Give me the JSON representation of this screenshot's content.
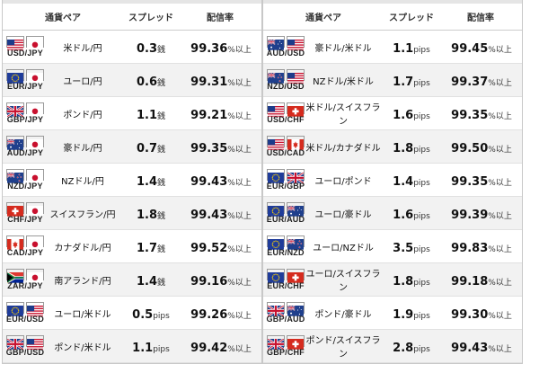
{
  "headers": {
    "pair": "通貨ペア",
    "spread": "スプレッド",
    "rate": "配信率"
  },
  "left": [
    {
      "code": "USD/JPY",
      "f1": "us",
      "f2": "jp",
      "name": "米ドル/円",
      "spread": "0.3",
      "unit": "銭",
      "rate": "99.36",
      "rate_unit": "%以上"
    },
    {
      "code": "EUR/JPY",
      "f1": "eu",
      "f2": "jp",
      "name": "ユーロ/円",
      "spread": "0.6",
      "unit": "銭",
      "rate": "99.31",
      "rate_unit": "%以上"
    },
    {
      "code": "GBP/JPY",
      "f1": "gb",
      "f2": "jp",
      "name": "ポンド/円",
      "spread": "1.1",
      "unit": "銭",
      "rate": "99.21",
      "rate_unit": "%以上"
    },
    {
      "code": "AUD/JPY",
      "f1": "au",
      "f2": "jp",
      "name": "豪ドル/円",
      "spread": "0.7",
      "unit": "銭",
      "rate": "99.35",
      "rate_unit": "%以上"
    },
    {
      "code": "NZD/JPY",
      "f1": "nz",
      "f2": "jp",
      "name": "NZドル/円",
      "spread": "1.4",
      "unit": "銭",
      "rate": "99.43",
      "rate_unit": "%以上"
    },
    {
      "code": "CHF/JPY",
      "f1": "ch",
      "f2": "jp",
      "name": "スイスフラン/円",
      "spread": "1.8",
      "unit": "銭",
      "rate": "99.43",
      "rate_unit": "%以上"
    },
    {
      "code": "CAD/JPY",
      "f1": "ca",
      "f2": "jp",
      "name": "カナダドル/円",
      "spread": "1.7",
      "unit": "銭",
      "rate": "99.52",
      "rate_unit": "%以上"
    },
    {
      "code": "ZAR/JPY",
      "f1": "za",
      "f2": "jp",
      "name": "南アランド/円",
      "spread": "1.4",
      "unit": "銭",
      "rate": "99.16",
      "rate_unit": "%以上"
    },
    {
      "code": "EUR/USD",
      "f1": "eu",
      "f2": "us",
      "name": "ユーロ/米ドル",
      "spread": "0.5",
      "unit": "pips",
      "rate": "99.26",
      "rate_unit": "%以上"
    },
    {
      "code": "GBP/USD",
      "f1": "gb",
      "f2": "us",
      "name": "ポンド/米ドル",
      "spread": "1.1",
      "unit": "pips",
      "rate": "99.42",
      "rate_unit": "%以上"
    }
  ],
  "right": [
    {
      "code": "AUD/USD",
      "f1": "au",
      "f2": "us",
      "name": "豪ドル/米ドル",
      "spread": "1.1",
      "unit": "pips",
      "rate": "99.45",
      "rate_unit": "%以上"
    },
    {
      "code": "NZD/USD",
      "f1": "nz",
      "f2": "us",
      "name": "NZドル/米ドル",
      "spread": "1.7",
      "unit": "pips",
      "rate": "99.37",
      "rate_unit": "%以上"
    },
    {
      "code": "USD/CHF",
      "f1": "us",
      "f2": "ch",
      "name": "米ドル/スイスフラン",
      "spread": "1.6",
      "unit": "pips",
      "rate": "99.35",
      "rate_unit": "%以上"
    },
    {
      "code": "USD/CAD",
      "f1": "us",
      "f2": "ca",
      "name": "米ドル/カナダドル",
      "spread": "1.8",
      "unit": "pips",
      "rate": "99.50",
      "rate_unit": "%以上"
    },
    {
      "code": "EUR/GBP",
      "f1": "eu",
      "f2": "gb",
      "name": "ユーロ/ポンド",
      "spread": "1.4",
      "unit": "pips",
      "rate": "99.35",
      "rate_unit": "%以上"
    },
    {
      "code": "EUR/AUD",
      "f1": "eu",
      "f2": "au",
      "name": "ユーロ/豪ドル",
      "spread": "1.6",
      "unit": "pips",
      "rate": "99.39",
      "rate_unit": "%以上"
    },
    {
      "code": "EUR/NZD",
      "f1": "eu",
      "f2": "nz",
      "name": "ユーロ/NZドル",
      "spread": "3.5",
      "unit": "pips",
      "rate": "99.83",
      "rate_unit": "%以上"
    },
    {
      "code": "EUR/CHF",
      "f1": "eu",
      "f2": "ch",
      "name": "ユーロ/スイスフラン",
      "spread": "1.8",
      "unit": "pips",
      "rate": "99.18",
      "rate_unit": "%以上"
    },
    {
      "code": "GBP/AUD",
      "f1": "gb",
      "f2": "au",
      "name": "ポンド/豪ドル",
      "spread": "1.9",
      "unit": "pips",
      "rate": "99.30",
      "rate_unit": "%以上"
    },
    {
      "code": "GBP/CHF",
      "f1": "gb",
      "f2": "ch",
      "name": "ポンド/スイスフラン",
      "spread": "2.8",
      "unit": "pips",
      "rate": "99.43",
      "rate_unit": "%以上"
    }
  ]
}
